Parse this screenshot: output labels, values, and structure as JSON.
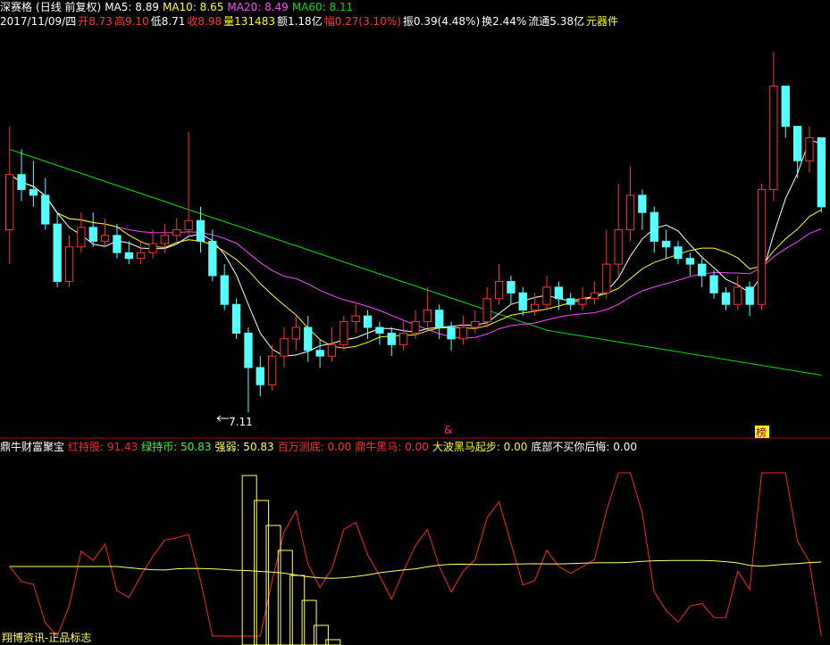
{
  "header": {
    "stock_name": "深赛格",
    "period": "(日线 前复权)",
    "ma5_label": "MA5: 8.89",
    "ma10_label": "MA10: 8.65",
    "ma20_label": "MA20: 8.49",
    "ma60_label": "MA60: 8.11"
  },
  "quote": {
    "date": "2017/11/09/四",
    "open": "开8.73",
    "high": "高9.10",
    "low": "低8.71",
    "close": "收8.98",
    "volume": "量131483",
    "amount": "额1.18亿",
    "change": "幅0.27(3.10%)",
    "amplitude": "振0.39(4.48%)",
    "turnover": "换2.44%",
    "float_cap": "流通5.38亿",
    "sector": "元器件"
  },
  "indicator": {
    "name": "鼎牛财富聚宝",
    "red_hold": "红持股: 91.43",
    "green_hold": "绿持币: 50.83",
    "strength": "强弱: 50.83",
    "million_bottom": "百万测底: 0.00",
    "bull_horse": "鼎牛黑马: 0.00",
    "wave_start": "大波黑马起步: 0.00",
    "regret": "底部不买你后悔: 0.00"
  },
  "annotations": {
    "low_marker": "7.11",
    "marker_mid": "&",
    "marker_right": "榜"
  },
  "footer_text": "翔博资讯-正品标志",
  "colors": {
    "up": "#ff3232",
    "down": "#54ffff",
    "ma5": "#ffffff",
    "ma10": "#ffff00",
    "ma20": "#ff44ff",
    "ma60": "#00dd00",
    "divider": "#aa0000",
    "ind_red": "#ff2020",
    "ind_green": "#30ff30",
    "ind_yellow": "#ffff66"
  },
  "chart_data": {
    "type": "candlestick",
    "y_reference": {
      "low_label_value": 7.11
    },
    "candles": [
      [
        8.7,
        9.18,
        9.6,
        8.4
      ],
      [
        9.18,
        9.05,
        9.4,
        8.95
      ],
      [
        9.05,
        9.0,
        9.3,
        8.9
      ],
      [
        9.0,
        8.75,
        9.15,
        8.7
      ],
      [
        8.75,
        8.25,
        8.85,
        8.2
      ],
      [
        8.25,
        8.55,
        8.65,
        8.2
      ],
      [
        8.55,
        8.72,
        8.85,
        8.5
      ],
      [
        8.72,
        8.6,
        8.85,
        8.55
      ],
      [
        8.6,
        8.65,
        8.8,
        8.55
      ],
      [
        8.65,
        8.5,
        8.75,
        8.45
      ],
      [
        8.5,
        8.45,
        8.6,
        8.4
      ],
      [
        8.45,
        8.5,
        8.6,
        8.4
      ],
      [
        8.5,
        8.58,
        8.7,
        8.45
      ],
      [
        8.58,
        8.65,
        8.75,
        8.5
      ],
      [
        8.65,
        8.7,
        8.8,
        8.6
      ],
      [
        8.7,
        8.78,
        9.55,
        8.65
      ],
      [
        8.78,
        8.6,
        8.9,
        8.5
      ],
      [
        8.6,
        8.3,
        8.7,
        8.25
      ],
      [
        8.3,
        8.05,
        8.4,
        8.0
      ],
      [
        8.05,
        7.8,
        8.1,
        7.75
      ],
      [
        7.8,
        7.5,
        7.85,
        7.11
      ],
      [
        7.5,
        7.35,
        7.6,
        7.25
      ],
      [
        7.35,
        7.6,
        7.7,
        7.3
      ],
      [
        7.6,
        7.75,
        7.85,
        7.5
      ],
      [
        7.75,
        7.85,
        7.95,
        7.65
      ],
      [
        7.85,
        7.65,
        7.95,
        7.55
      ],
      [
        7.65,
        7.6,
        7.75,
        7.5
      ],
      [
        7.6,
        7.7,
        7.85,
        7.55
      ],
      [
        7.7,
        7.9,
        7.95,
        7.65
      ],
      [
        7.9,
        7.95,
        8.05,
        7.8
      ],
      [
        7.95,
        7.85,
        8.0,
        7.75
      ],
      [
        7.85,
        7.8,
        7.9,
        7.7
      ],
      [
        7.8,
        7.7,
        7.85,
        7.6
      ],
      [
        7.7,
        7.8,
        7.9,
        7.65
      ],
      [
        7.8,
        7.9,
        8.0,
        7.75
      ],
      [
        7.9,
        8.0,
        8.2,
        7.85
      ],
      [
        8.0,
        7.85,
        8.05,
        7.75
      ],
      [
        7.85,
        7.75,
        7.9,
        7.65
      ],
      [
        7.75,
        7.85,
        7.95,
        7.7
      ],
      [
        7.85,
        7.9,
        8.0,
        7.8
      ],
      [
        7.9,
        8.1,
        8.2,
        7.85
      ],
      [
        8.1,
        8.25,
        8.4,
        8.05
      ],
      [
        8.25,
        8.15,
        8.3,
        8.05
      ],
      [
        8.15,
        8.0,
        8.2,
        7.95
      ],
      [
        8.0,
        8.05,
        8.15,
        7.95
      ],
      [
        8.05,
        8.2,
        8.3,
        8.0
      ],
      [
        8.2,
        8.1,
        8.25,
        8.0
      ],
      [
        8.1,
        8.05,
        8.15,
        8.0
      ],
      [
        8.05,
        8.1,
        8.2,
        8.0
      ],
      [
        8.1,
        8.15,
        8.25,
        8.05
      ],
      [
        8.15,
        8.4,
        8.7,
        8.1
      ],
      [
        8.4,
        8.7,
        9.1,
        8.3
      ],
      [
        8.7,
        9.0,
        9.25,
        8.6
      ],
      [
        9.0,
        8.85,
        9.05,
        8.7
      ],
      [
        8.85,
        8.6,
        8.9,
        8.5
      ],
      [
        8.6,
        8.55,
        8.7,
        8.45
      ],
      [
        8.55,
        8.45,
        8.6,
        8.4
      ],
      [
        8.45,
        8.4,
        8.5,
        8.3
      ],
      [
        8.4,
        8.3,
        8.45,
        8.2
      ],
      [
        8.3,
        8.15,
        8.35,
        8.1
      ],
      [
        8.15,
        8.05,
        8.2,
        8.0
      ],
      [
        8.05,
        8.2,
        8.3,
        8.0
      ],
      [
        8.2,
        8.05,
        8.25,
        7.95
      ],
      [
        8.05,
        9.05,
        9.1,
        8.0
      ],
      [
        9.05,
        9.95,
        10.25,
        8.95
      ],
      [
        9.95,
        9.6,
        9.85,
        9.5
      ],
      [
        9.6,
        9.3,
        9.55,
        9.15
      ],
      [
        9.3,
        9.5,
        9.6,
        9.2
      ],
      [
        9.5,
        8.9,
        9.45,
        8.85
      ]
    ]
  }
}
